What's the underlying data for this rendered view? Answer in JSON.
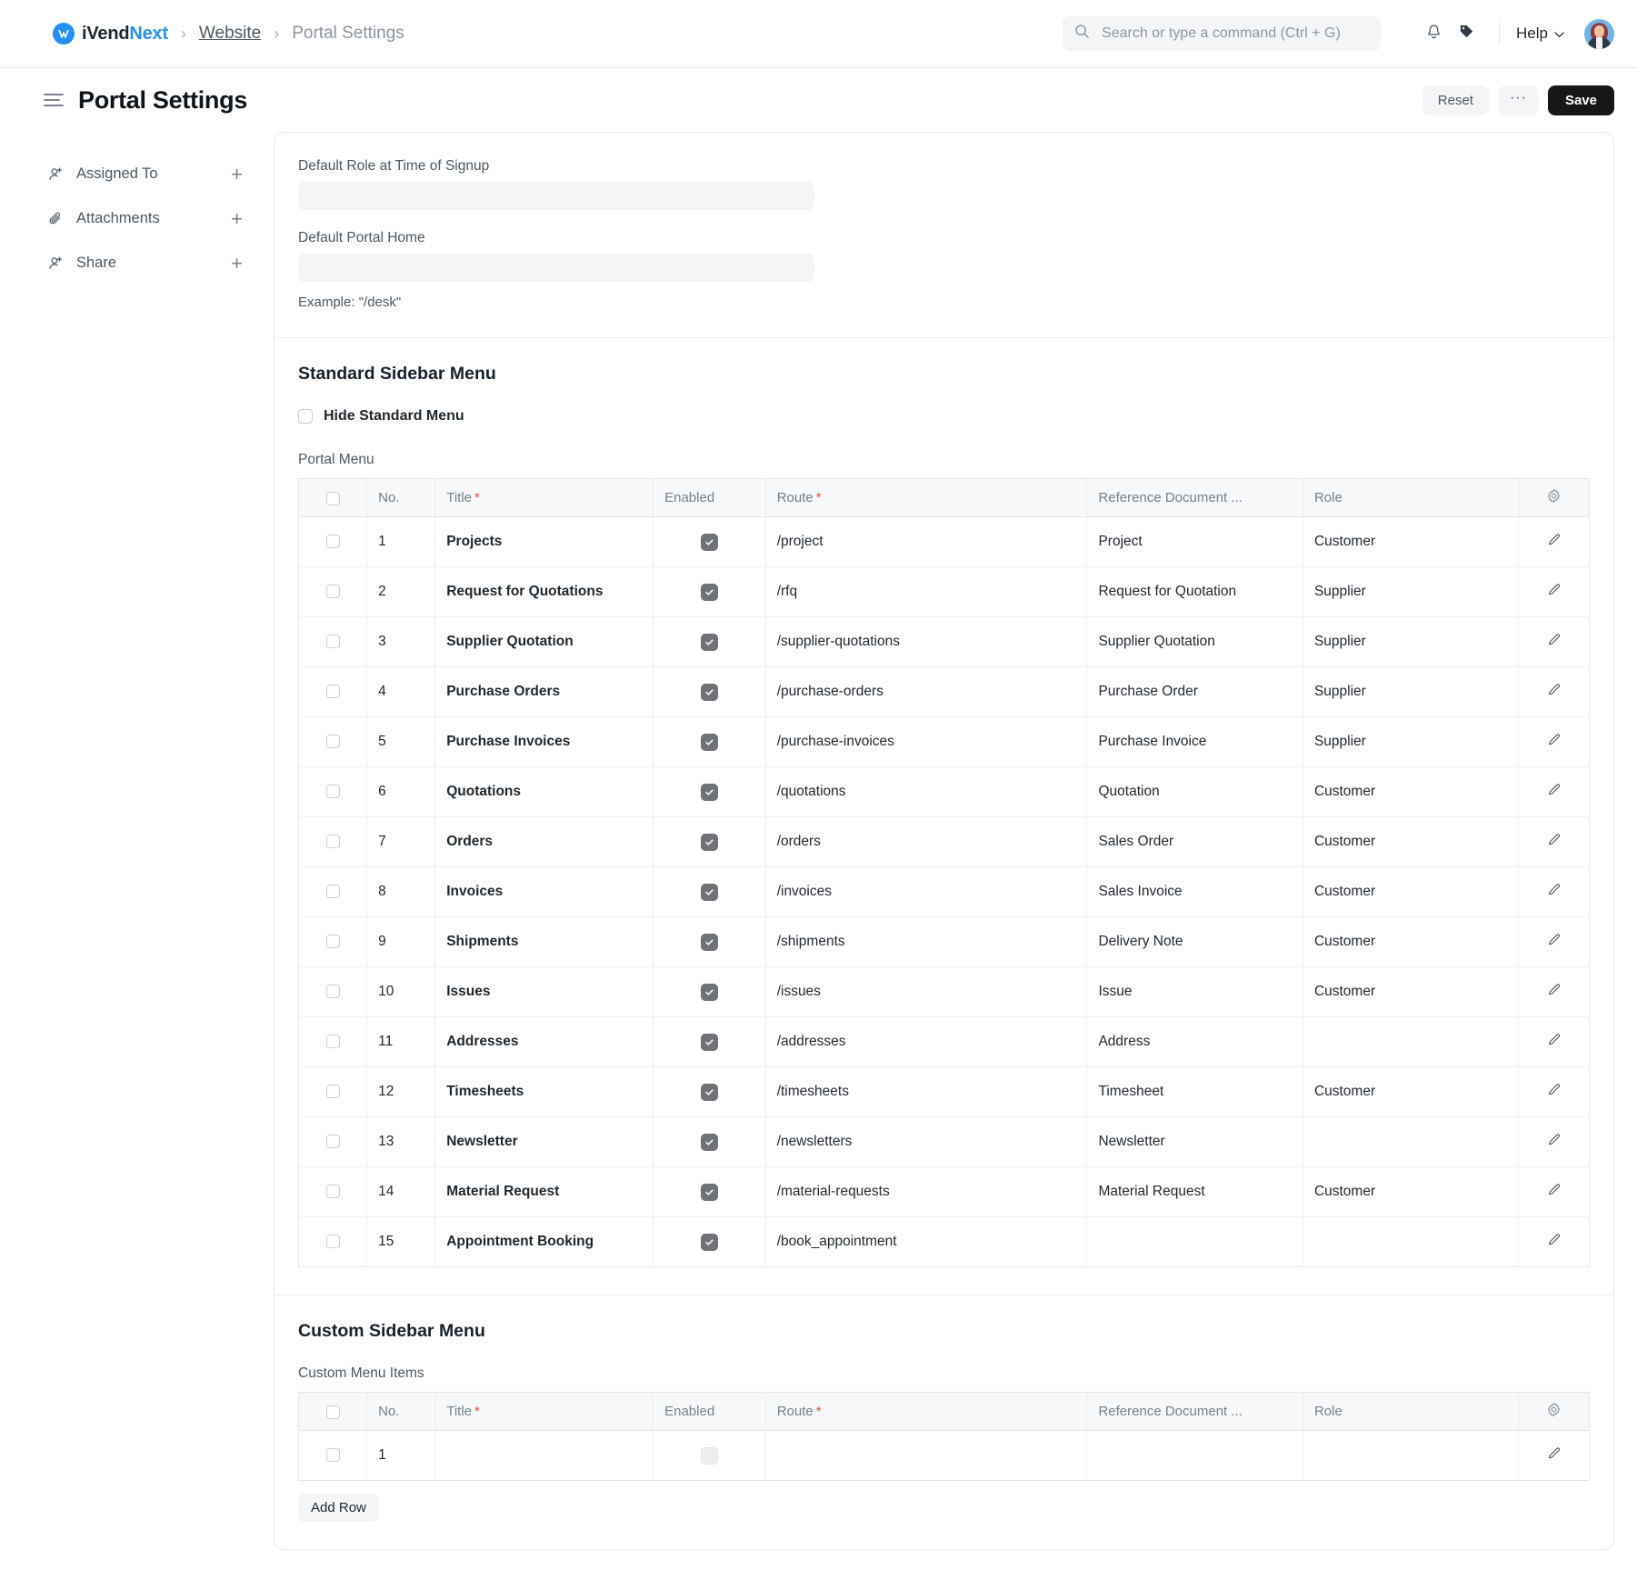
{
  "navbar": {
    "brand_first": "iVend",
    "brand_second": "Next",
    "brand_mark": "M",
    "breadcrumb": [
      "Website",
      "Portal Settings"
    ],
    "search_placeholder": "Search or type a command (Ctrl + G)",
    "search_value": "",
    "help_label": "Help"
  },
  "page": {
    "title": "Portal Settings",
    "reset_label": "Reset",
    "more_label": "···",
    "save_label": "Save"
  },
  "sidebar": {
    "items": [
      {
        "label": "Assigned To",
        "icon": "user-add-icon",
        "add": "+"
      },
      {
        "label": "Attachments",
        "icon": "paperclip-icon",
        "add": "+"
      },
      {
        "label": "Share",
        "icon": "share-user-icon",
        "add": "+"
      }
    ]
  },
  "settings": {
    "default_role_label": "Default Role at Time of Signup",
    "default_role_value": "",
    "default_role_placeholder": "",
    "default_home_label": "Default Portal Home",
    "default_home_value": "",
    "default_home_placeholder": "",
    "example_help": "Example: \"/desk\""
  },
  "standard_section": {
    "title": "Standard Sidebar Menu",
    "hide_checkbox_label": "Hide Standard Menu",
    "hide_checkbox_checked": false,
    "grid_label": "Portal Menu",
    "columns": [
      "No.",
      "Title",
      "Enabled",
      "Route",
      "Reference Document ...",
      "Role"
    ],
    "required_columns": [
      "Title",
      "Route"
    ],
    "rows": [
      {
        "no": "1",
        "title": "Projects",
        "enabled": true,
        "route": "/project",
        "ref": "Project",
        "role": "Customer"
      },
      {
        "no": "2",
        "title": "Request for Quotations",
        "enabled": true,
        "route": "/rfq",
        "ref": "Request for Quotation",
        "role": "Supplier"
      },
      {
        "no": "3",
        "title": "Supplier Quotation",
        "enabled": true,
        "route": "/supplier-quotations",
        "ref": "Supplier Quotation",
        "role": "Supplier"
      },
      {
        "no": "4",
        "title": "Purchase Orders",
        "enabled": true,
        "route": "/purchase-orders",
        "ref": "Purchase Order",
        "role": "Supplier"
      },
      {
        "no": "5",
        "title": "Purchase Invoices",
        "enabled": true,
        "route": "/purchase-invoices",
        "ref": "Purchase Invoice",
        "role": "Supplier"
      },
      {
        "no": "6",
        "title": "Quotations",
        "enabled": true,
        "route": "/quotations",
        "ref": "Quotation",
        "role": "Customer"
      },
      {
        "no": "7",
        "title": "Orders",
        "enabled": true,
        "route": "/orders",
        "ref": "Sales Order",
        "role": "Customer"
      },
      {
        "no": "8",
        "title": "Invoices",
        "enabled": true,
        "route": "/invoices",
        "ref": "Sales Invoice",
        "role": "Customer"
      },
      {
        "no": "9",
        "title": "Shipments",
        "enabled": true,
        "route": "/shipments",
        "ref": "Delivery Note",
        "role": "Customer"
      },
      {
        "no": "10",
        "title": "Issues",
        "enabled": true,
        "route": "/issues",
        "ref": "Issue",
        "role": "Customer"
      },
      {
        "no": "11",
        "title": "Addresses",
        "enabled": true,
        "route": "/addresses",
        "ref": "Address",
        "role": ""
      },
      {
        "no": "12",
        "title": "Timesheets",
        "enabled": true,
        "route": "/timesheets",
        "ref": "Timesheet",
        "role": "Customer"
      },
      {
        "no": "13",
        "title": "Newsletter",
        "enabled": true,
        "route": "/newsletters",
        "ref": "Newsletter",
        "role": ""
      },
      {
        "no": "14",
        "title": "Material Request",
        "enabled": true,
        "route": "/material-requests",
        "ref": "Material Request",
        "role": "Customer"
      },
      {
        "no": "15",
        "title": "Appointment Booking",
        "enabled": true,
        "route": "/book_appointment",
        "ref": "",
        "role": ""
      }
    ]
  },
  "custom_section": {
    "title": "Custom Sidebar Menu",
    "grid_label": "Custom Menu Items",
    "columns": [
      "No.",
      "Title",
      "Enabled",
      "Route",
      "Reference Document ...",
      "Role"
    ],
    "rows": [
      {
        "no": "1",
        "title": "",
        "enabled": false,
        "route": "",
        "ref": "",
        "role": ""
      }
    ],
    "add_row_label": "Add Row"
  },
  "colors": {
    "accent": "#2490ef",
    "primary_button": "#171717",
    "required_star": "#e24c4c",
    "checkbox_on": "#6f7276"
  }
}
